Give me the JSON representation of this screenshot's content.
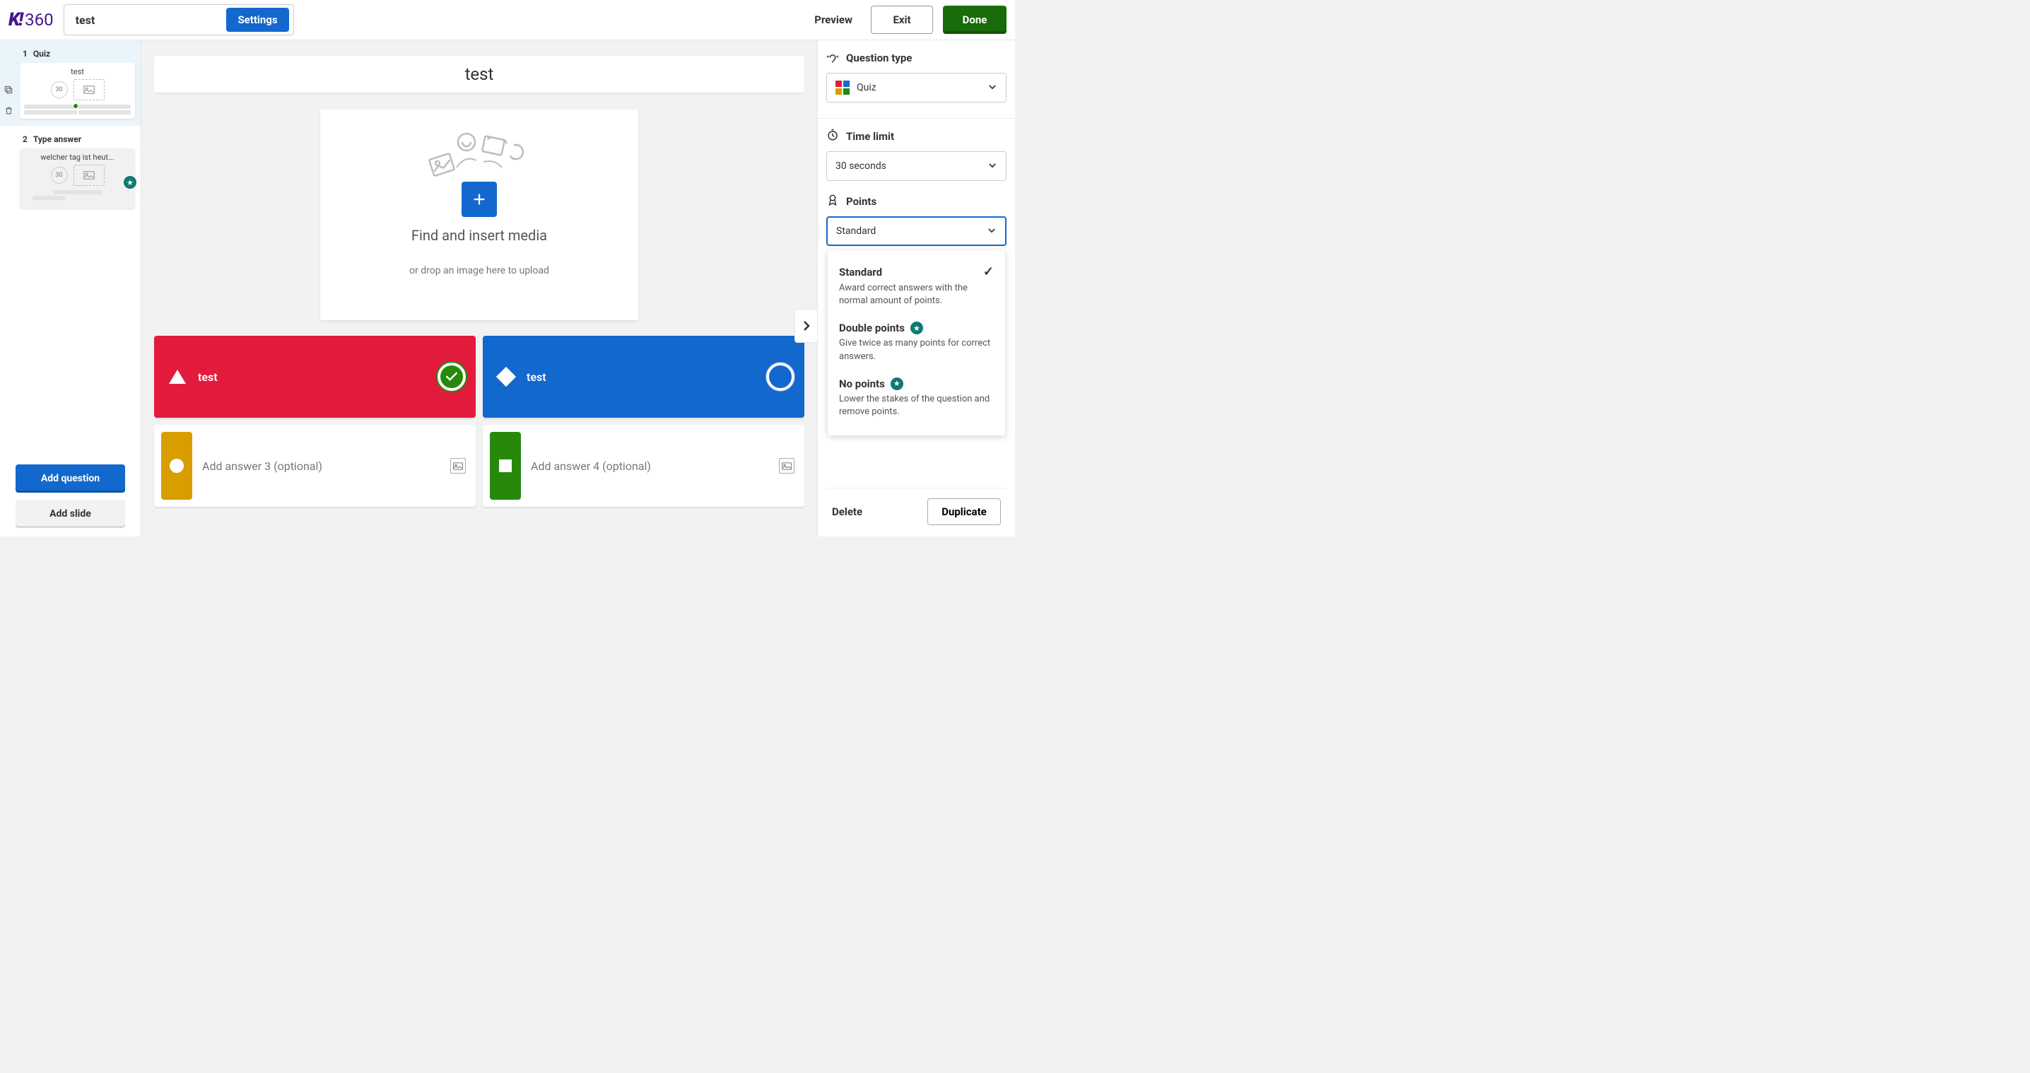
{
  "header": {
    "title_value": "test",
    "settings_label": "Settings",
    "preview_label": "Preview",
    "exit_label": "Exit",
    "done_label": "Done"
  },
  "sidebar": {
    "slides": [
      {
        "index": "1",
        "type": "Quiz",
        "title": "test",
        "time": "30"
      },
      {
        "index": "2",
        "type": "Type answer",
        "title": "welcher tag ist heut...",
        "time": "30"
      }
    ],
    "add_question_label": "Add question",
    "add_slide_label": "Add slide"
  },
  "editor": {
    "question_text": "test",
    "media_find_label": "Find and insert media",
    "media_drop_label": "or drop an image here to upload",
    "answers": [
      {
        "text": "test",
        "placeholder": "",
        "filled": true,
        "color": "red",
        "correct": true,
        "shape": "triangle"
      },
      {
        "text": "test",
        "placeholder": "",
        "filled": true,
        "color": "blue",
        "correct": false,
        "shape": "diamond"
      },
      {
        "text": "",
        "placeholder": "Add answer 3 (optional)",
        "filled": false,
        "color": "yellow",
        "correct": false,
        "shape": "circle"
      },
      {
        "text": "",
        "placeholder": "Add answer 4 (optional)",
        "filled": false,
        "color": "green",
        "correct": false,
        "shape": "square"
      }
    ]
  },
  "rpanel": {
    "question_type_label": "Question type",
    "question_type_value": "Quiz",
    "time_limit_label": "Time limit",
    "time_limit_value": "30 seconds",
    "points_label": "Points",
    "points_value": "Standard",
    "points_options": [
      {
        "title": "Standard",
        "desc": "Award correct answers with the normal amount of points.",
        "selected": true,
        "premium": false
      },
      {
        "title": "Double points",
        "desc": "Give twice as many points for correct answers.",
        "selected": false,
        "premium": true
      },
      {
        "title": "No points",
        "desc": "Lower the stakes of the question and remove points.",
        "selected": false,
        "premium": true
      }
    ],
    "delete_label": "Delete",
    "duplicate_label": "Duplicate"
  }
}
